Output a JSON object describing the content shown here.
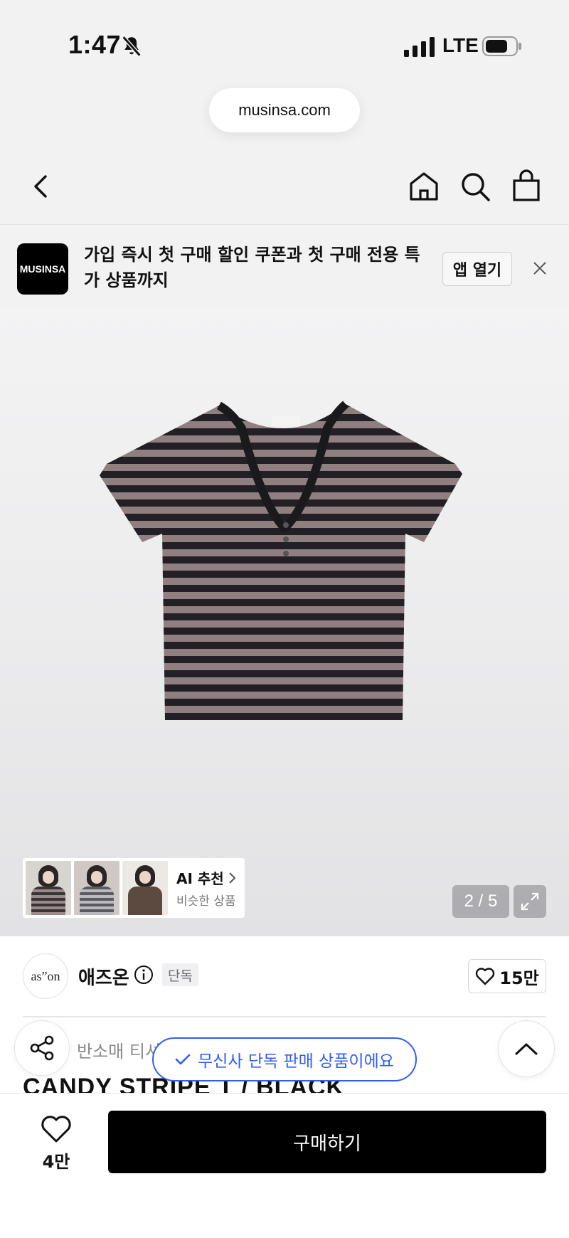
{
  "status_bar": {
    "time": "1:47",
    "network": "LTE"
  },
  "browser": {
    "url": "musinsa.com"
  },
  "banner": {
    "logo": "MUSINSA",
    "text": "가입 즉시 첫 구매 할인 쿠폰과 첫 구매 전용 특가 상품까지",
    "open_app": "앱 열기"
  },
  "gallery": {
    "counter": "2 / 5",
    "ai_title": "AI 추천",
    "ai_sub": "비슷한 상품"
  },
  "brand": {
    "logo_text": "as”on",
    "name": "애즈온",
    "exclusive": "단독",
    "likes": "15만"
  },
  "product": {
    "category": "반소매 티셔",
    "title": "CANDY STRIPE T / BLACK",
    "toast": "무신사 단독 판매 상품이에요"
  },
  "bottom": {
    "wish_count": "4만",
    "buy_label": "구매하기"
  },
  "colors": {
    "accent_blue": "#2f5ef4",
    "stripe_dark": "#222024",
    "stripe_light": "#8f7f80"
  }
}
